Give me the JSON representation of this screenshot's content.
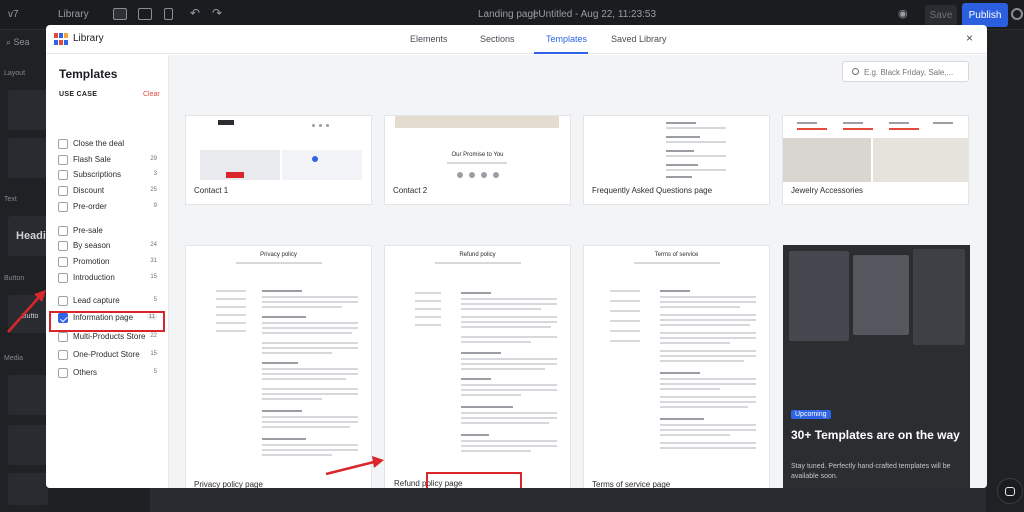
{
  "editor": {
    "version_label": "v7",
    "library_button": "Library",
    "page_name": "Landing page",
    "doc_title": "| Untitled - Aug 22, 11:23:53",
    "save_label": "Save",
    "publish_label": "Publish",
    "search_label": "Sea",
    "section_labels": [
      "Layout",
      "Text",
      "Button",
      "Media"
    ],
    "heading_label": "Headi",
    "button_label": "Butto",
    "accent_color": "#2c5fe0"
  },
  "modal": {
    "title": "Library",
    "tabs": [
      {
        "label": "Elements",
        "active": false
      },
      {
        "label": "Sections",
        "active": false
      },
      {
        "label": "Templates",
        "active": true
      },
      {
        "label": "Saved Library",
        "active": false
      }
    ],
    "close_label": "×",
    "search_placeholder": "E.g. Black Friday, Sale,...",
    "sidebar": {
      "title": "Templates",
      "subtitle": "USE CASE",
      "clear_label": "Clear",
      "options": [
        {
          "label": "Close the deal",
          "count": "",
          "checked": false
        },
        {
          "label": "Flash Sale",
          "count": "29",
          "checked": false
        },
        {
          "label": "Subscriptions",
          "count": "3",
          "checked": false
        },
        {
          "label": "Discount",
          "count": "25",
          "checked": false
        },
        {
          "label": "Pre-order",
          "count": "9",
          "checked": false
        },
        {
          "label": "Pre-sale",
          "count": "",
          "checked": false
        },
        {
          "label": "By season",
          "count": "24",
          "checked": false
        },
        {
          "label": "Promotion",
          "count": "31",
          "checked": false
        },
        {
          "label": "Introduction",
          "count": "15",
          "checked": false
        },
        {
          "label": "Lead capture",
          "count": "5",
          "checked": false
        },
        {
          "label": "Information page",
          "count": "11",
          "checked": true
        },
        {
          "label": "Multi-Products Store",
          "count": "22",
          "checked": false
        },
        {
          "label": "One-Product Store",
          "count": "15",
          "checked": false
        },
        {
          "label": "Others",
          "count": "5",
          "checked": false
        }
      ]
    },
    "templates_top": [
      {
        "caption": "Contact 1"
      },
      {
        "caption": "Contact 2"
      },
      {
        "caption": "Frequently Asked Questions page"
      },
      {
        "caption": "Jewelry Accessories"
      }
    ],
    "templates_bottom": [
      {
        "caption": "Privacy policy page",
        "preview_title": "Privacy policy"
      },
      {
        "caption": "Refund policy page",
        "preview_title": "Refund policy"
      },
      {
        "caption": "Terms of service page",
        "preview_title": "Terms of service"
      }
    ],
    "contact2_text": "Our Promise to You",
    "upcoming": {
      "badge": "Upcoming",
      "title": "30+ Templates are on the way",
      "description": "Stay tuned. Perfectly hand-crafted templates will be available soon."
    },
    "annotation_color": "#d9262b"
  }
}
